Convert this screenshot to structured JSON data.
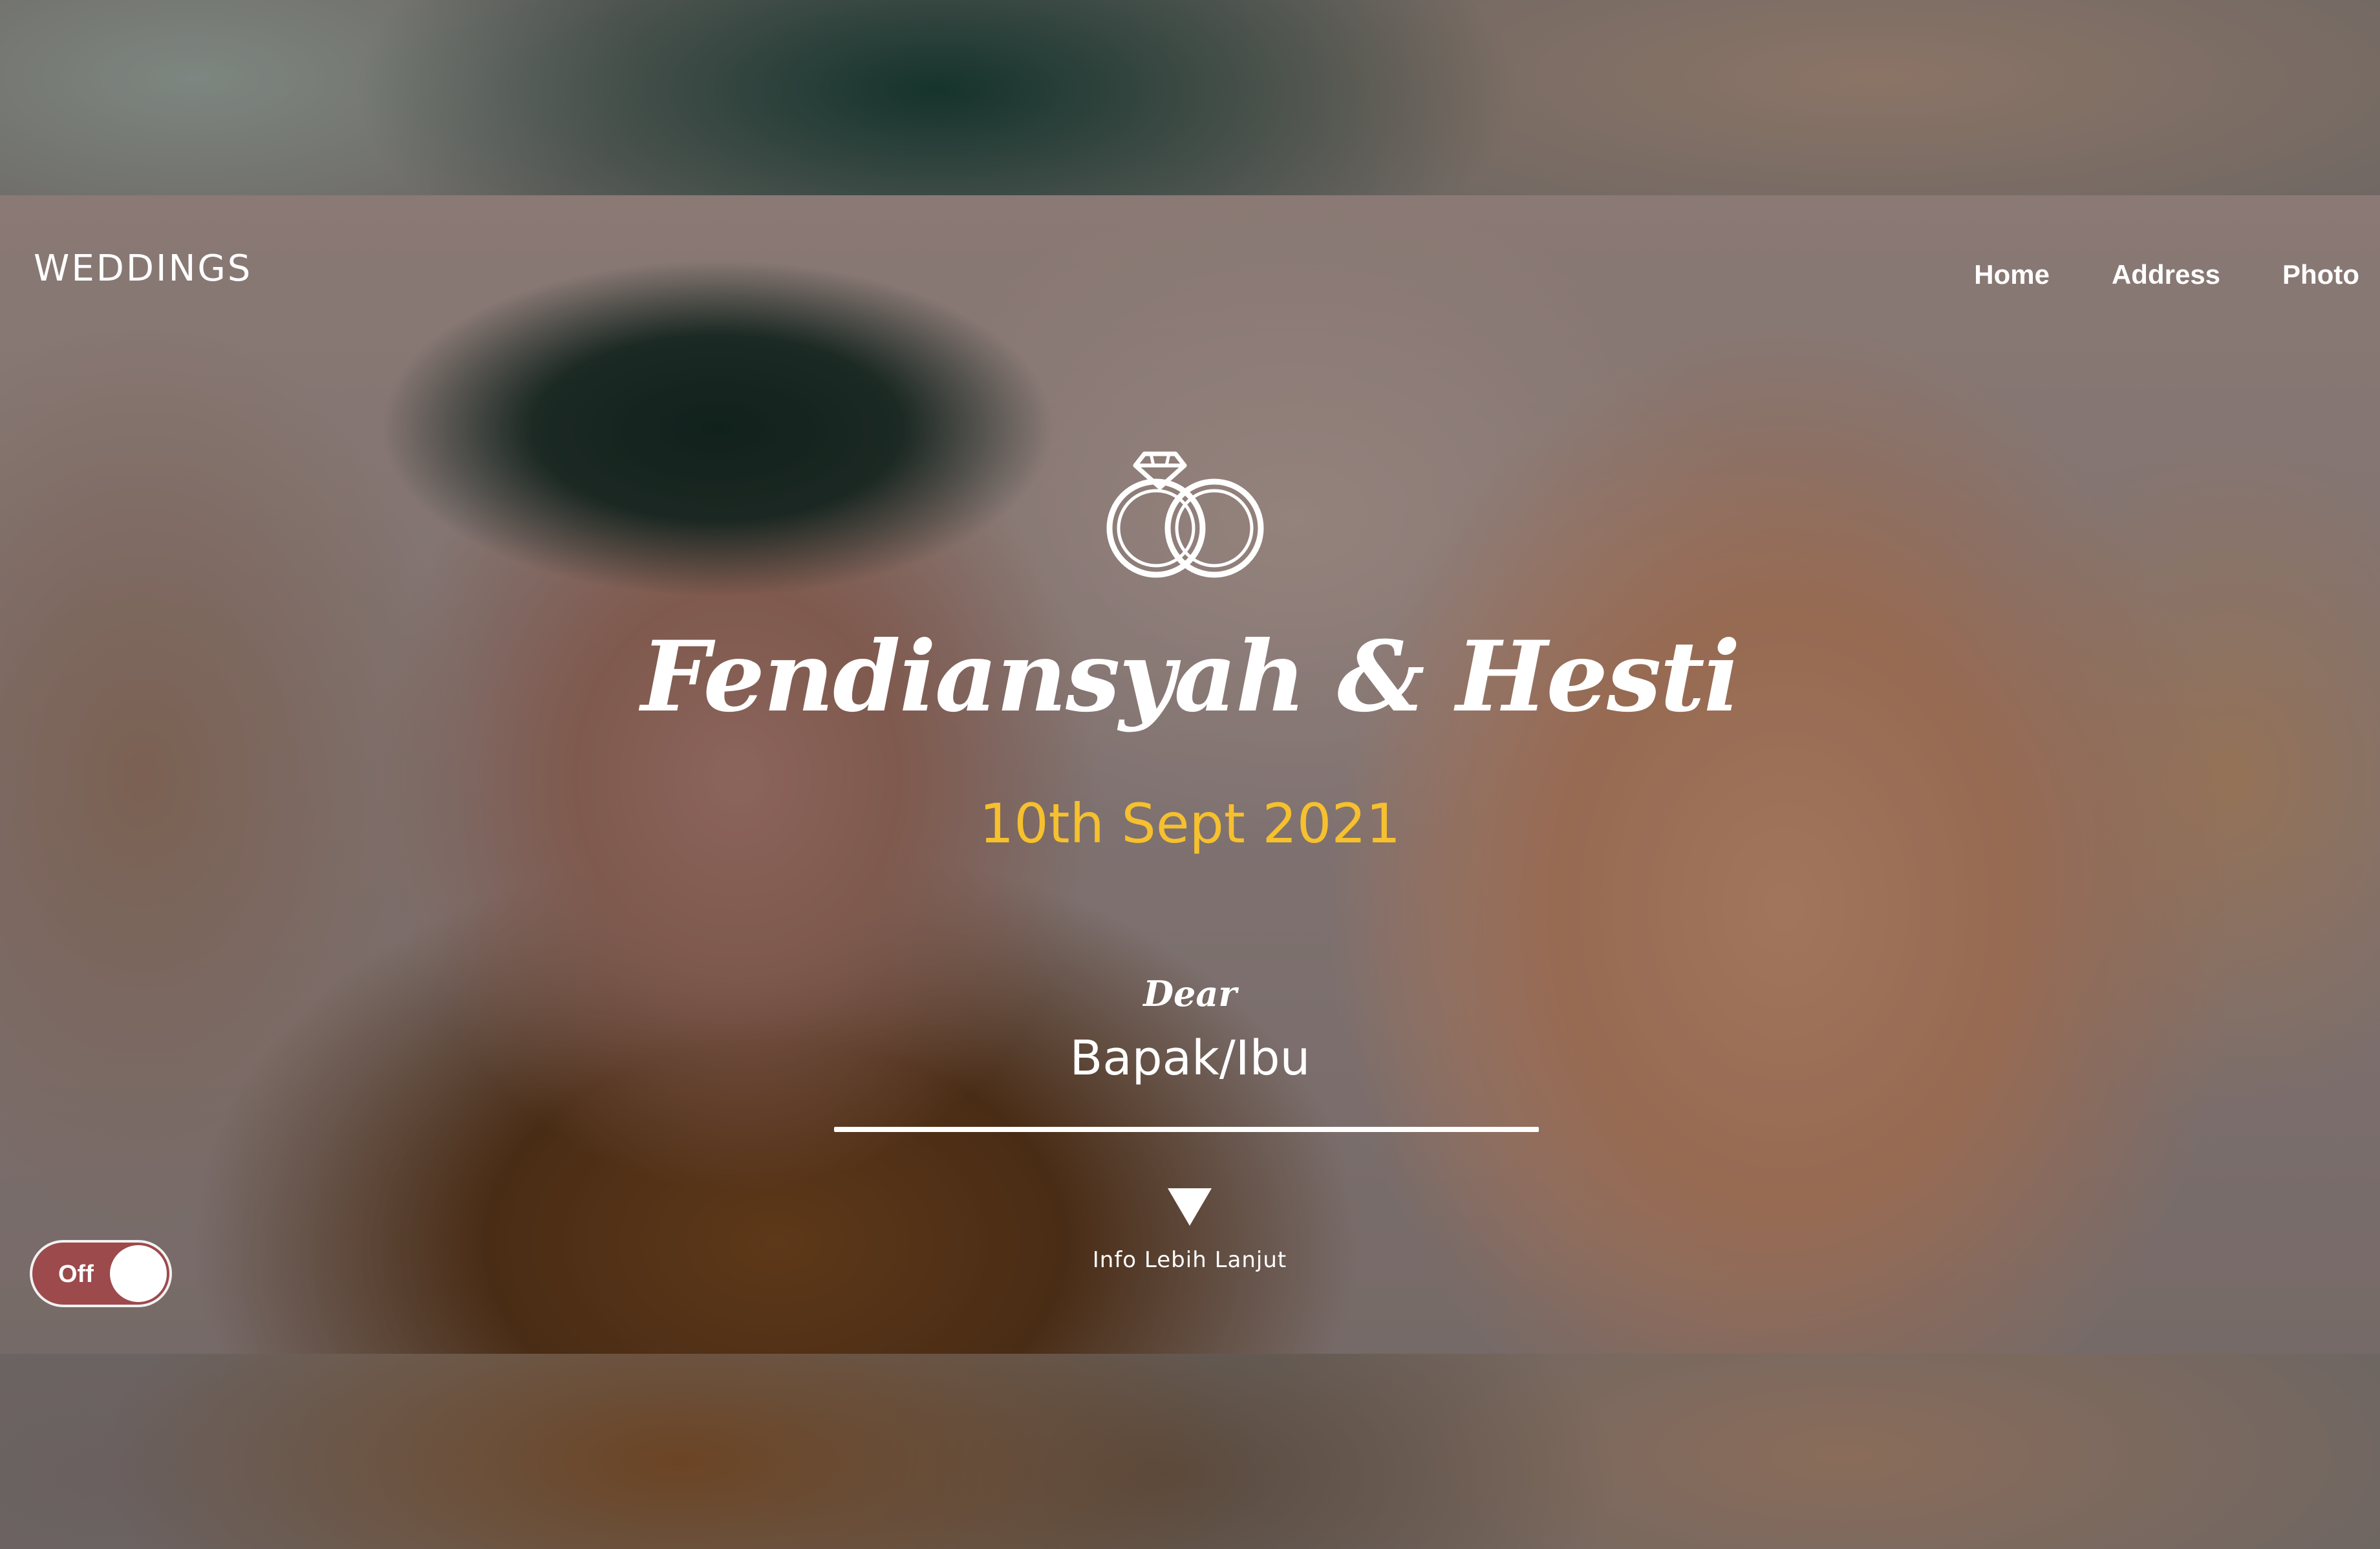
{
  "brand": {
    "title": "WEDDINGS"
  },
  "nav": {
    "items": [
      {
        "label": "Home"
      },
      {
        "label": "Address"
      },
      {
        "label": "Photo"
      }
    ]
  },
  "hero": {
    "icon": "wedding-rings-icon",
    "couple_names": "Fendiansyah & Hesti",
    "date": "10th Sept 2021",
    "greeting": "Dear",
    "guest_name": "Bapak/Ibu",
    "more_info_label": "Info Lebih Lanjut",
    "more_info_icon": "triangle-down-icon"
  },
  "music_toggle": {
    "label": "Off",
    "state": "off"
  },
  "colors": {
    "accent_date": "#f6c02e",
    "text": "#ffffff",
    "toggle_off": "#9c4a4c"
  }
}
